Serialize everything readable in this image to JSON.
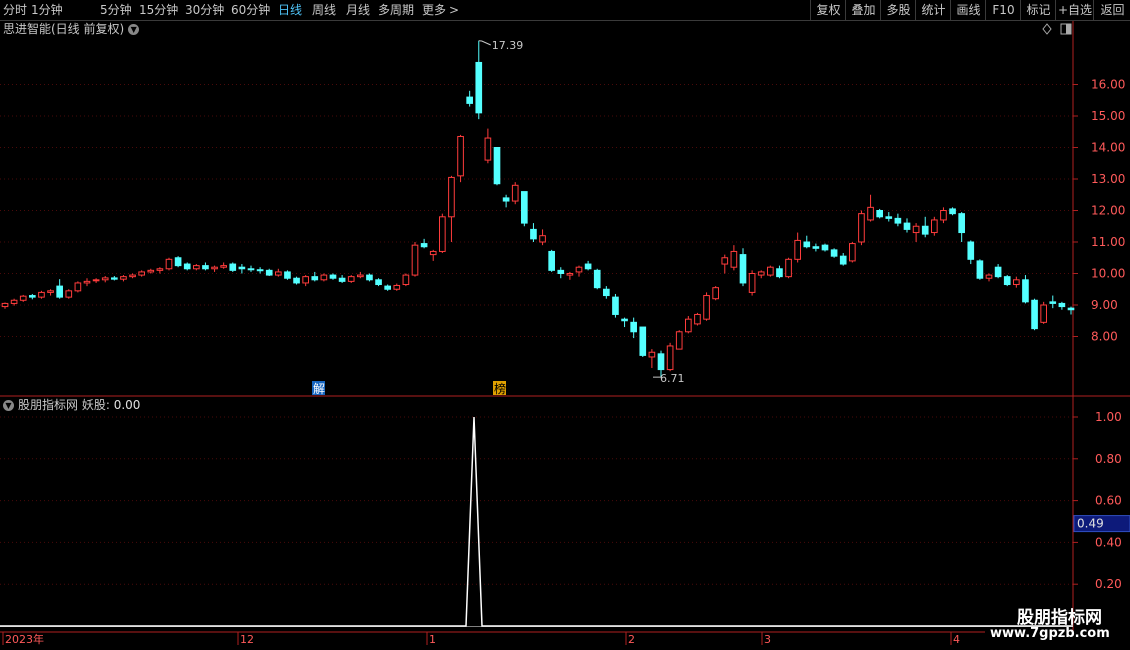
{
  "toolbar": {
    "periods": [
      {
        "label": "分时",
        "x": 3
      },
      {
        "label": "1分钟",
        "x": 31
      },
      {
        "label": "5分钟",
        "x": 100
      },
      {
        "label": "15分钟",
        "x": 139
      },
      {
        "label": "30分钟",
        "x": 185
      },
      {
        "label": "60分钟",
        "x": 231
      },
      {
        "label": "日线",
        "x": 278,
        "active": true
      },
      {
        "label": "周线",
        "x": 312
      },
      {
        "label": "月线",
        "x": 346
      },
      {
        "label": "多周期",
        "x": 378
      },
      {
        "label": "更多",
        "x": 422
      }
    ],
    "more_arrow": ">",
    "right_buttons": [
      "复权",
      "叠加",
      "多股",
      "统计",
      "画线",
      "F10",
      "标记",
      "+自选",
      "返回"
    ]
  },
  "main_chart": {
    "title": "思进智能(日线 前复权)",
    "high_label": "17.39",
    "low_label": "6.71",
    "marker_jie": "解",
    "marker_bang": "榜",
    "y_ticks": [
      "8.00",
      "9.00",
      "10.00",
      "11.00",
      "12.00",
      "13.00",
      "14.00",
      "15.00",
      "16.00"
    ]
  },
  "indicator": {
    "title": "股朋指标网 妖股:",
    "value": "0.00",
    "y_ticks": [
      "0.20",
      "0.40",
      "0.60",
      "0.80",
      "1.00"
    ],
    "current_tag": "0.49"
  },
  "x_axis": {
    "labels": [
      "2023年",
      "12",
      "1",
      "2",
      "3",
      "4"
    ]
  },
  "watermark": {
    "text_cn": "股朋指标网",
    "url": "www.7gpzb.com"
  },
  "colors": {
    "up": "#ff3c3c",
    "down": "#54ffff",
    "axis": "#b02020",
    "grid": "#4a0a0a",
    "active": "#4fc3f7",
    "tag_bg": "#0d1a7a"
  }
}
